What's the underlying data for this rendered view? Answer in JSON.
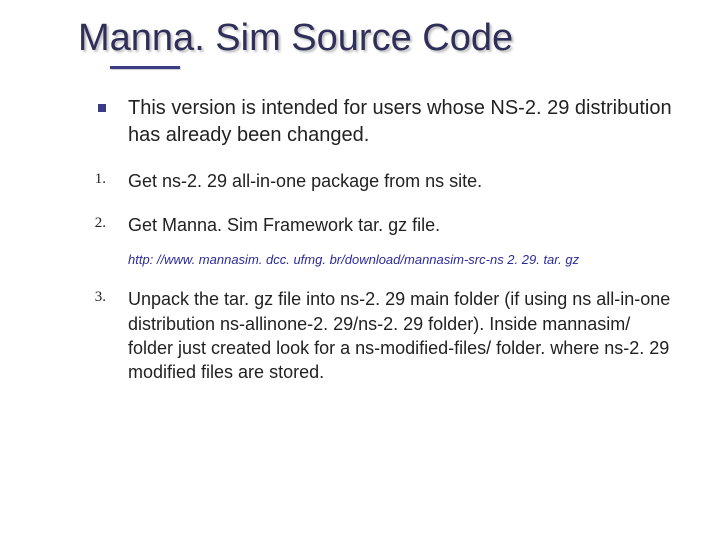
{
  "title": "Manna. Sim Source Code",
  "intro": "This version is intended for users whose NS-2. 29 distribution has already been changed.",
  "steps": {
    "markers": [
      "1.",
      "2.",
      "3."
    ],
    "text1": "Get ns-2. 29 all-in-one package from ns site.",
    "text2": "Get Manna. Sim Framework tar. gz file.",
    "link": "http: //www. mannasim. dcc. ufmg. br/download/mannasim-src-ns 2. 29. tar. gz",
    "text3": "Unpack the tar. gz file into ns-2. 29 main folder (if using ns all-in-one distribution ns-allinone-2. 29/ns-2. 29 folder). Inside mannasim/ folder just created look for a ns-modified-files/ folder. where ns-2. 29 modified files are stored."
  }
}
